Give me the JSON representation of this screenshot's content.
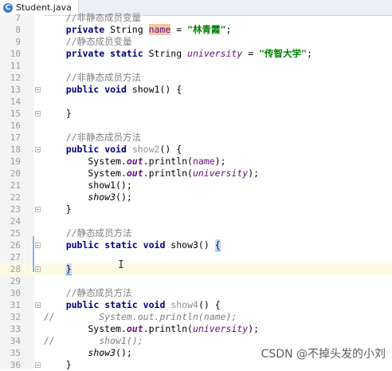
{
  "tab": {
    "label": "Student.java",
    "icon": "java-class-icon"
  },
  "lines": [
    {
      "n": "7",
      "kind": "top",
      "text": "    //非静态成员变量"
    },
    {
      "n": "8",
      "kind": "l8"
    },
    {
      "n": "9",
      "kind": "c",
      "text": "    //静态成员变量"
    },
    {
      "n": "10",
      "kind": "l10"
    },
    {
      "n": "11",
      "kind": "blank"
    },
    {
      "n": "12",
      "kind": "c",
      "text": "    //非静态成员方法"
    },
    {
      "n": "13",
      "kind": "sig",
      "static": false,
      "name": "show1",
      "unused": false
    },
    {
      "n": "14",
      "kind": "blank"
    },
    {
      "n": "15",
      "kind": "close"
    },
    {
      "n": "16",
      "kind": "blank"
    },
    {
      "n": "17",
      "kind": "c",
      "text": "    //非静态成员方法"
    },
    {
      "n": "18",
      "kind": "sig",
      "static": false,
      "name": "show2",
      "unused": true
    },
    {
      "n": "19",
      "kind": "print",
      "field": "name",
      "italic": false
    },
    {
      "n": "20",
      "kind": "print",
      "field": "university",
      "italic": true
    },
    {
      "n": "21",
      "kind": "call",
      "name": "show1",
      "italic": false
    },
    {
      "n": "22",
      "kind": "call",
      "name": "show3",
      "italic": true
    },
    {
      "n": "23",
      "kind": "close"
    },
    {
      "n": "24",
      "kind": "blank"
    },
    {
      "n": "25",
      "kind": "c",
      "text": "    //静态成员方法"
    },
    {
      "n": "26",
      "kind": "sig3"
    },
    {
      "n": "27",
      "kind": "blank"
    },
    {
      "n": "28",
      "kind": "close3"
    },
    {
      "n": "29",
      "kind": "blank"
    },
    {
      "n": "30",
      "kind": "c",
      "text": "    //静态成员方法"
    },
    {
      "n": "31",
      "kind": "sig",
      "static": true,
      "name": "show4",
      "unused": true
    },
    {
      "n": "32",
      "kind": "cprint",
      "text": "//        System.out.println(name);"
    },
    {
      "n": "33",
      "kind": "print",
      "field": "university",
      "italic": true
    },
    {
      "n": "34",
      "kind": "cprint",
      "text": "//        show1();"
    },
    {
      "n": "35",
      "kind": "call",
      "name": "show3",
      "italic": true
    },
    {
      "n": "36",
      "kind": "close"
    }
  ],
  "tokens": {
    "private": "private",
    "public": "public",
    "static": "static",
    "void": "void",
    "string": "String",
    "name": "name",
    "university": "university",
    "name_value": "\"林青霞\"",
    "university_value": "\"传智大学\"",
    "system": "System",
    "out": "out",
    "println": "println"
  },
  "watermark": "CSDN @不掉头发的小刘"
}
